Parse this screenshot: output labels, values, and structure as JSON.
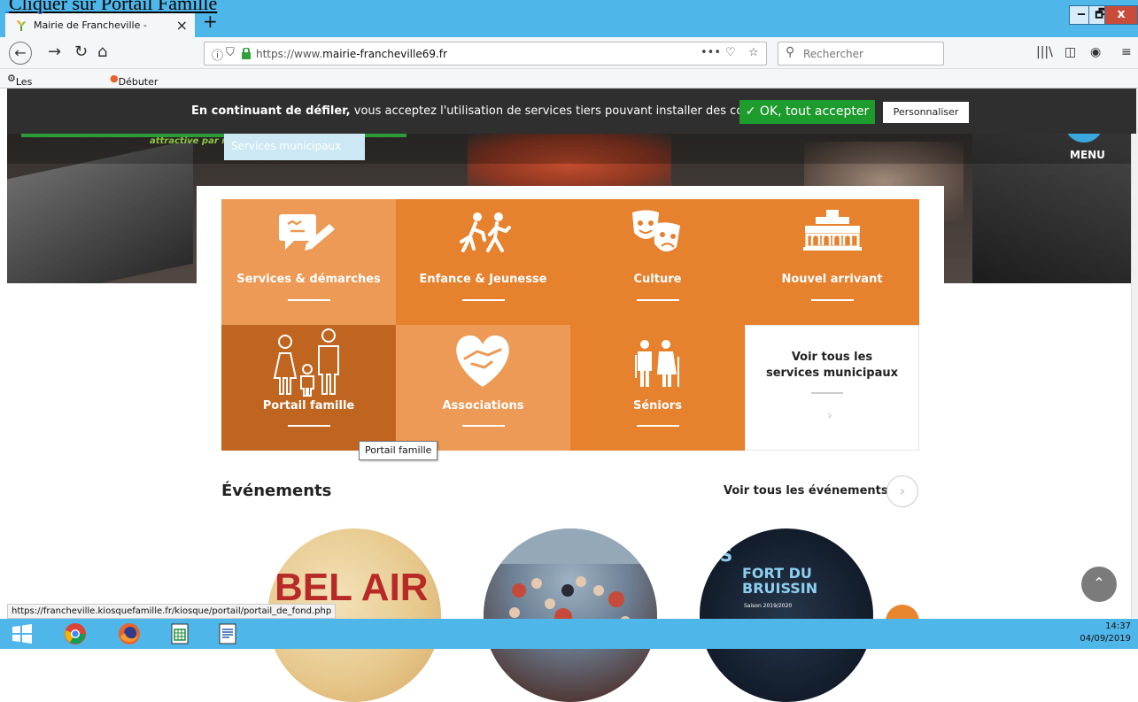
{
  "instruction": "Cliquer sur Portail Famille",
  "browser": {
    "tab_title": "Mairie de Francheville -",
    "tab_close": "×",
    "new_tab": "+",
    "url_prefix": "https://www.",
    "url_domain": "mairie-francheville69.fr",
    "page_actions": "•••",
    "search_placeholder": "Rechercher",
    "window_buttons": {
      "minimize": "‒",
      "maximize": "🗗",
      "close": "x"
    },
    "bookmarks": [
      {
        "label": "Les plus visités",
        "icon": "gear-icon"
      },
      {
        "label": "Débuter avec Firefox",
        "icon": "firefox-icon"
      }
    ]
  },
  "cookie_banner": {
    "bold": "En continuant de défiler,",
    "text": " vous acceptez l'utilisation de services tiers pouvant installer des cookies",
    "accept": "✓ OK, tout accepter",
    "customize": "Personnaliser"
  },
  "site_header": {
    "tagline": "attractive par nature",
    "services_pill": "Services municipaux",
    "menu_label": "MENU"
  },
  "tiles": [
    {
      "label": "Services & démarches",
      "icon": "services-icon",
      "color": "#ec9a55"
    },
    {
      "label": "Enfance & Jeunesse",
      "icon": "children-running-icon",
      "color": "#e6812e"
    },
    {
      "label": "Culture",
      "icon": "theater-masks-icon",
      "color": "#e6812e"
    },
    {
      "label": "Nouvel arrivant",
      "icon": "town-hall-icon",
      "color": "#e6812e"
    },
    {
      "label": "Portail famille",
      "icon": "family-icon",
      "color": "#c0651f"
    },
    {
      "label": "Associations",
      "icon": "handshake-heart-icon",
      "color": "#ec9a55"
    },
    {
      "label": "Séniors",
      "icon": "seniors-icon",
      "color": "#e6812e"
    },
    {
      "label": "Voir tous les services municipaux",
      "icon": "chevron-right-icon",
      "color": "#ffffff"
    }
  ],
  "tooltip": "Portail famille",
  "events": {
    "title": "Événements",
    "link": "Voir tous les événements",
    "arrow": "›",
    "items": [
      {
        "text": "BEL AIR"
      },
      {
        "text": ""
      },
      {
        "text": "RIS",
        "text2": "FORT DU BRUISSIN",
        "text3": "Saison 2019/2020"
      }
    ]
  },
  "status_url": "https://francheville.kiosquefamille.fr/kiosque/portail/portail_de_fond.php",
  "taskbar": {
    "time": "14:37",
    "date": "04/09/2019"
  }
}
